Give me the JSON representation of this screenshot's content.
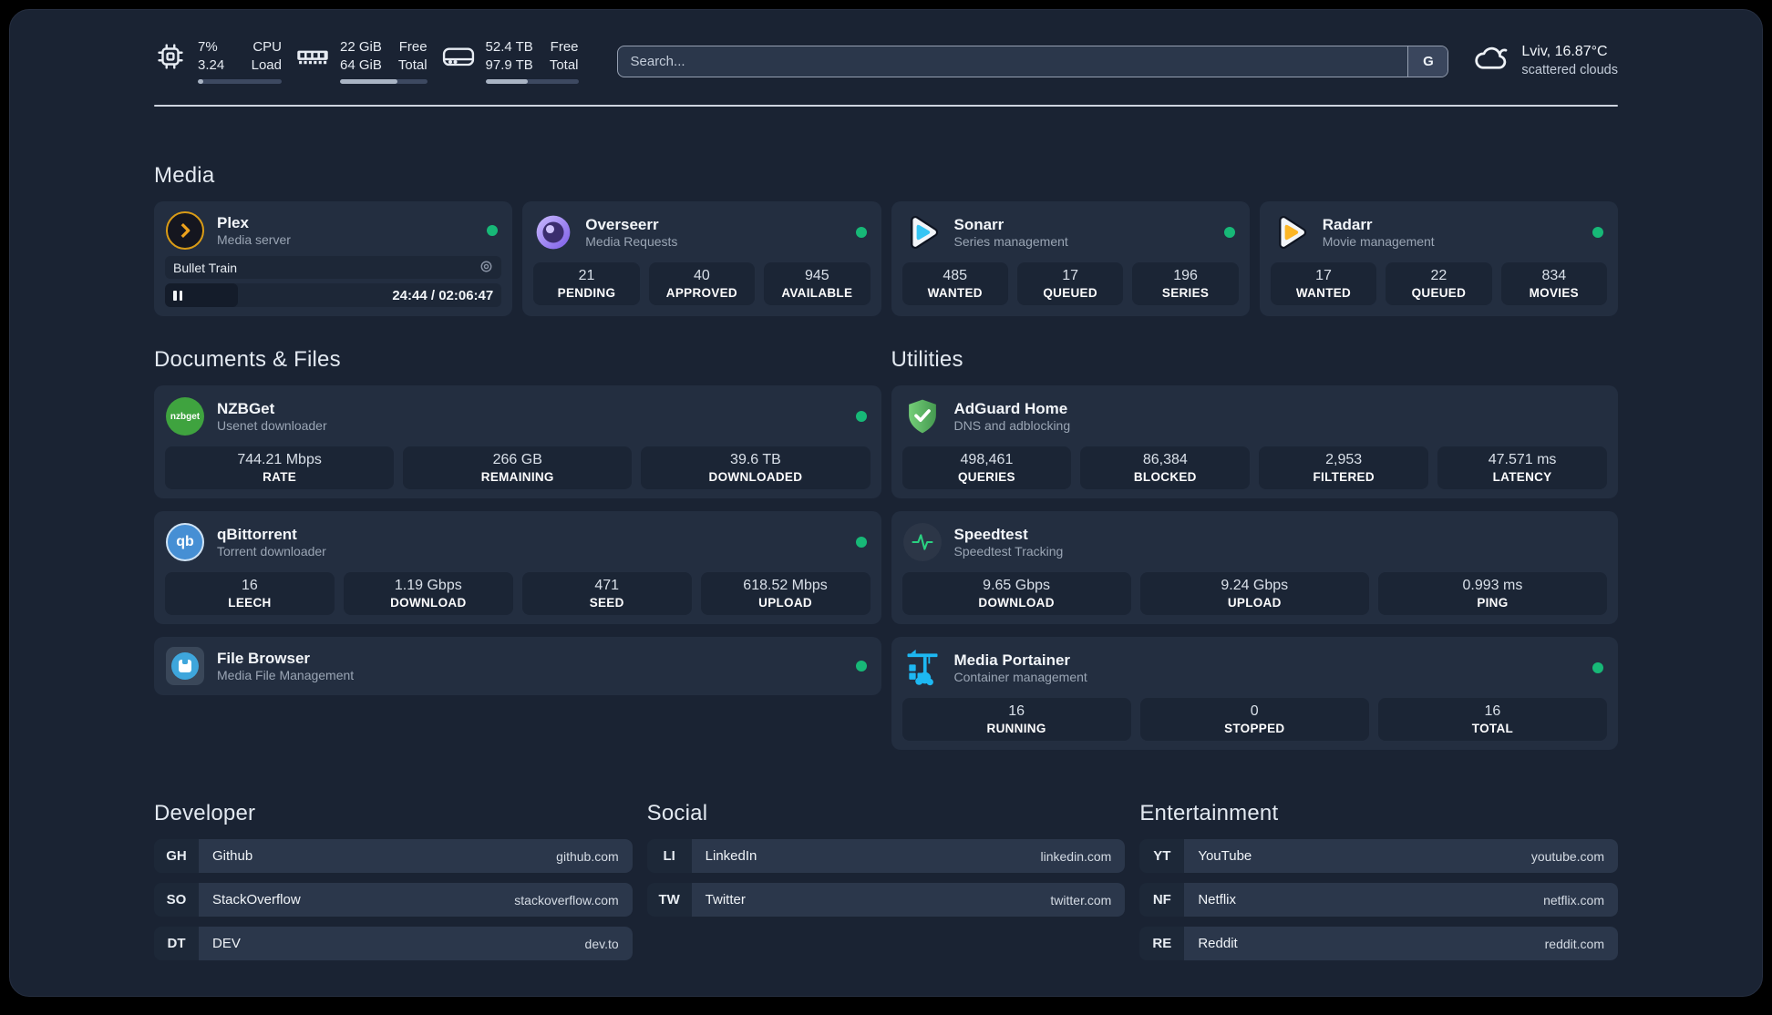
{
  "header": {
    "cpu": {
      "value1": "7%",
      "value2": "3.24",
      "label1": "CPU",
      "label2": "Load",
      "progress": 7
    },
    "ram": {
      "value1": "22 GiB",
      "value2": "64 GiB",
      "label1": "Free",
      "label2": "Total",
      "progress": 66
    },
    "disk": {
      "value1": "52.4 TB",
      "value2": "97.9 TB",
      "label1": "Free",
      "label2": "Total",
      "progress": 46
    },
    "search": {
      "placeholder": "Search...",
      "engine_button": "G"
    },
    "weather": {
      "location": "Lviv, 16.87°C",
      "condition": "scattered clouds"
    }
  },
  "media": {
    "title": "Media",
    "plex": {
      "name": "Plex",
      "description": "Media server",
      "now_playing": "Bullet Train",
      "time": "24:44 / 02:06:47"
    },
    "overseerr": {
      "name": "Overseerr",
      "description": "Media Requests",
      "stats": [
        {
          "value": "21",
          "label": "PENDING"
        },
        {
          "value": "40",
          "label": "APPROVED"
        },
        {
          "value": "945",
          "label": "AVAILABLE"
        }
      ]
    },
    "sonarr": {
      "name": "Sonarr",
      "description": "Series management",
      "stats": [
        {
          "value": "485",
          "label": "WANTED"
        },
        {
          "value": "17",
          "label": "QUEUED"
        },
        {
          "value": "196",
          "label": "SERIES"
        }
      ]
    },
    "radarr": {
      "name": "Radarr",
      "description": "Movie management",
      "stats": [
        {
          "value": "17",
          "label": "WANTED"
        },
        {
          "value": "22",
          "label": "QUEUED"
        },
        {
          "value": "834",
          "label": "MOVIES"
        }
      ]
    }
  },
  "documents": {
    "title": "Documents & Files",
    "nzbget": {
      "name": "NZBGet",
      "description": "Usenet downloader",
      "icon_text": "nzbget",
      "stats": [
        {
          "value": "744.21 Mbps",
          "label": "RATE"
        },
        {
          "value": "266 GB",
          "label": "REMAINING"
        },
        {
          "value": "39.6 TB",
          "label": "DOWNLOADED"
        }
      ]
    },
    "qbittorrent": {
      "name": "qBittorrent",
      "description": "Torrent downloader",
      "icon_text": "qb",
      "stats": [
        {
          "value": "16",
          "label": "LEECH"
        },
        {
          "value": "1.19 Gbps",
          "label": "DOWNLOAD"
        },
        {
          "value": "471",
          "label": "SEED"
        },
        {
          "value": "618.52 Mbps",
          "label": "UPLOAD"
        }
      ]
    },
    "filebrowser": {
      "name": "File Browser",
      "description": "Media File Management"
    }
  },
  "utilities": {
    "title": "Utilities",
    "adguard": {
      "name": "AdGuard Home",
      "description": "DNS and adblocking",
      "stats": [
        {
          "value": "498,461",
          "label": "QUERIES"
        },
        {
          "value": "86,384",
          "label": "BLOCKED"
        },
        {
          "value": "2,953",
          "label": "FILTERED"
        },
        {
          "value": "47.571 ms",
          "label": "LATENCY"
        }
      ]
    },
    "speedtest": {
      "name": "Speedtest",
      "description": "Speedtest Tracking",
      "stats": [
        {
          "value": "9.65 Gbps",
          "label": "DOWNLOAD"
        },
        {
          "value": "9.24 Gbps",
          "label": "UPLOAD"
        },
        {
          "value": "0.993 ms",
          "label": "PING"
        }
      ]
    },
    "portainer": {
      "name": "Media Portainer",
      "description": "Container management",
      "stats": [
        {
          "value": "16",
          "label": "RUNNING"
        },
        {
          "value": "0",
          "label": "STOPPED"
        },
        {
          "value": "16",
          "label": "TOTAL"
        }
      ]
    }
  },
  "bookmarks": {
    "developer": {
      "title": "Developer",
      "items": [
        {
          "abbr": "GH",
          "name": "Github",
          "url": "github.com"
        },
        {
          "abbr": "SO",
          "name": "StackOverflow",
          "url": "stackoverflow.com"
        },
        {
          "abbr": "DT",
          "name": "DEV",
          "url": "dev.to"
        }
      ]
    },
    "social": {
      "title": "Social",
      "items": [
        {
          "abbr": "LI",
          "name": "LinkedIn",
          "url": "linkedin.com"
        },
        {
          "abbr": "TW",
          "name": "Twitter",
          "url": "twitter.com"
        }
      ]
    },
    "entertainment": {
      "title": "Entertainment",
      "items": [
        {
          "abbr": "YT",
          "name": "YouTube",
          "url": "youtube.com"
        },
        {
          "abbr": "NF",
          "name": "Netflix",
          "url": "netflix.com"
        },
        {
          "abbr": "RE",
          "name": "Reddit",
          "url": "reddit.com"
        }
      ]
    }
  },
  "colors": {
    "status_online": "#17b877",
    "accent_plex": "#e5a00d",
    "accent_overseerr": "#8b5cf6",
    "accent_sonarr": "#35c5f4",
    "accent_radarr": "#fcb626",
    "accent_adguard": "#57b65c",
    "accent_portainer": "#1db8f2",
    "accent_speedtest": "#2ad181"
  }
}
